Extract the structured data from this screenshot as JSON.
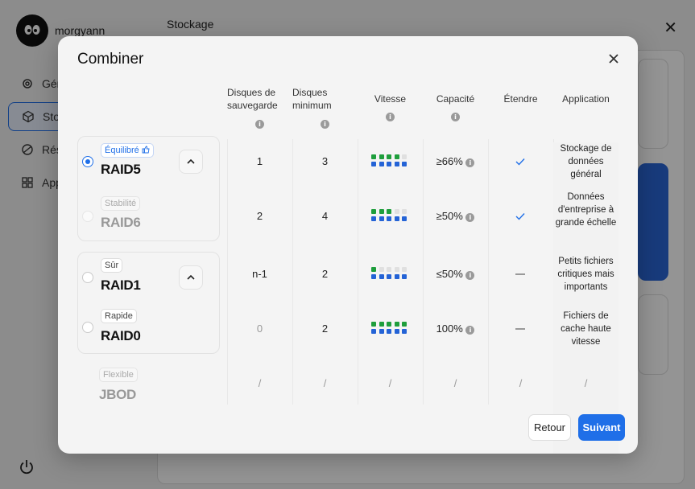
{
  "app": {
    "username": "morgyann",
    "page_title": "Stockage",
    "sidebar": [
      {
        "label": "Général",
        "icon": "gear-icon"
      },
      {
        "label": "Stockage",
        "icon": "cube-icon"
      },
      {
        "label": "Réseau",
        "icon": "network-icon"
      },
      {
        "label": "Applications",
        "icon": "apps-icon"
      }
    ]
  },
  "modal": {
    "title": "Combiner",
    "columns": {
      "backup": "Disques de sauvegarde",
      "minimum": "Disques minimum",
      "speed": "Vitesse",
      "capacity": "Capacité",
      "extend": "Étendre",
      "application": "Application"
    },
    "raids": [
      {
        "tag": "Équilibré",
        "name": "RAID5",
        "selected": true,
        "backup": "1",
        "minimum": "3",
        "speed_level": 4,
        "capacity": "≥66%",
        "extend": true,
        "application": "Stockage de données général"
      },
      {
        "tag": "Stabilité",
        "name": "RAID6",
        "selected": false,
        "backup": "2",
        "minimum": "4",
        "speed_level": 3,
        "capacity": "≥50%",
        "extend": true,
        "application": "Données d'entreprise à grande échelle"
      },
      {
        "tag": "Sûr",
        "name": "RAID1",
        "selected": false,
        "backup": "n-1",
        "minimum": "2",
        "speed_level": 1,
        "capacity": "≤50%",
        "extend": false,
        "application": "Petits fichiers critiques mais importants"
      },
      {
        "tag": "Rapide",
        "name": "RAID0",
        "selected": false,
        "backup": "0",
        "minimum": "2",
        "speed_level": 5,
        "capacity": "100%",
        "extend": false,
        "application": "Fichiers de cache haute vitesse"
      },
      {
        "tag": "Flexible",
        "name": "JBOD",
        "selected": false,
        "backup": "/",
        "minimum": "/",
        "speed": "/",
        "capacity": "/",
        "extend_text": "/",
        "application": "/"
      }
    ],
    "buttons": {
      "back": "Retour",
      "next": "Suivant"
    },
    "colors": {
      "accent": "#1f6fe8",
      "speed_green": "#1e9e3c",
      "speed_blue": "#2463d6",
      "speed_empty": "#e0e0e0"
    }
  }
}
